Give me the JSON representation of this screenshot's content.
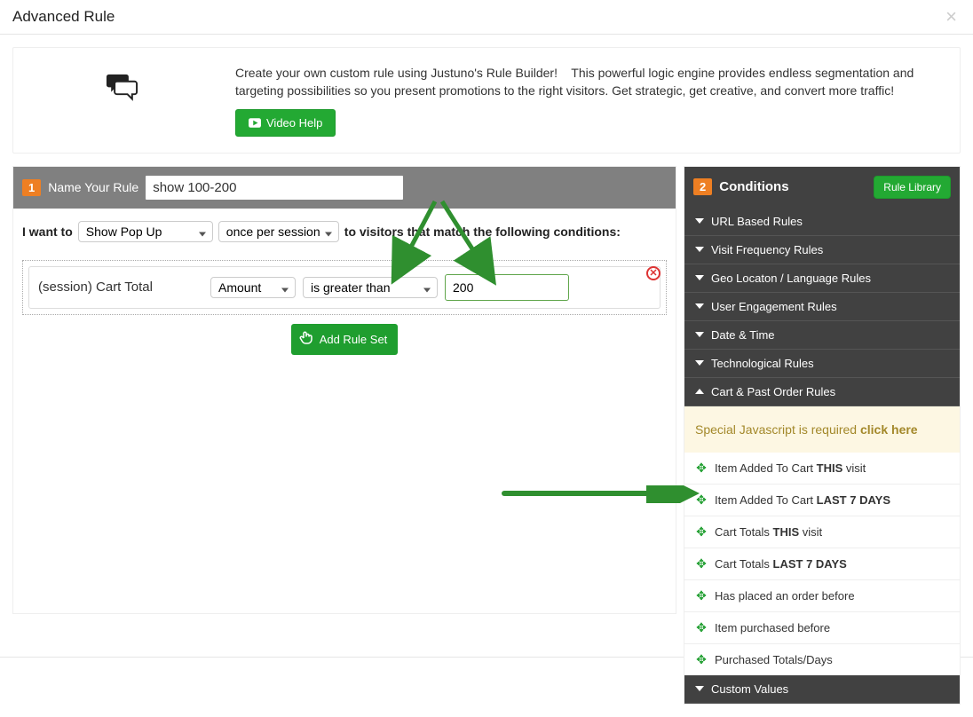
{
  "modal": {
    "title": "Advanced Rule"
  },
  "intro": {
    "text": "Create your own custom rule using Justuno's Rule Builder!    This powerful logic engine provides endless segmentation and targeting possibilities so you present promotions to the right visitors. Get strategic, get creative, and convert more traffic!",
    "video_button": "Video Help"
  },
  "step1": {
    "badge": "1",
    "label": "Name Your Rule",
    "value": "show 100-200"
  },
  "sentence": {
    "prefix": "I want to",
    "action_value": "Show Pop Up",
    "freq_value": "once per session",
    "suffix": "to visitors that match the following conditions:"
  },
  "condition": {
    "label": "(session) Cart Total",
    "field_value": "Amount",
    "op_value": "is greater than",
    "input_value": "200"
  },
  "buttons": {
    "add_rule_set": "Add Rule Set"
  },
  "step2": {
    "badge": "2",
    "title": "Conditions",
    "library_btn": "Rule Library"
  },
  "categories": [
    {
      "label": "URL Based Rules",
      "expanded": false
    },
    {
      "label": "Visit Frequency Rules",
      "expanded": false
    },
    {
      "label": "Geo Locaton / Language Rules",
      "expanded": false
    },
    {
      "label": "User Engagement Rules",
      "expanded": false
    },
    {
      "label": "Date & Time",
      "expanded": false
    },
    {
      "label": "Technological Rules",
      "expanded": false
    },
    {
      "label": "Cart & Past Order Rules",
      "expanded": true
    },
    {
      "label": "Custom Values",
      "expanded": false
    }
  ],
  "notice": {
    "text": "Special Javascript is required ",
    "link": "click here"
  },
  "cart_rules": [
    {
      "pre": "Item Added To Cart ",
      "bold": "THIS",
      "post": " visit"
    },
    {
      "pre": "Item Added To Cart ",
      "bold": "LAST 7 DAYS",
      "post": ""
    },
    {
      "pre": "Cart Totals ",
      "bold": "THIS",
      "post": " visit"
    },
    {
      "pre": "Cart Totals ",
      "bold": "LAST 7 DAYS",
      "post": ""
    },
    {
      "pre": "Has placed an order before",
      "bold": "",
      "post": ""
    },
    {
      "pre": "Item purchased before",
      "bold": "",
      "post": ""
    },
    {
      "pre": "Purchased Totals/Days",
      "bold": "",
      "post": ""
    }
  ]
}
